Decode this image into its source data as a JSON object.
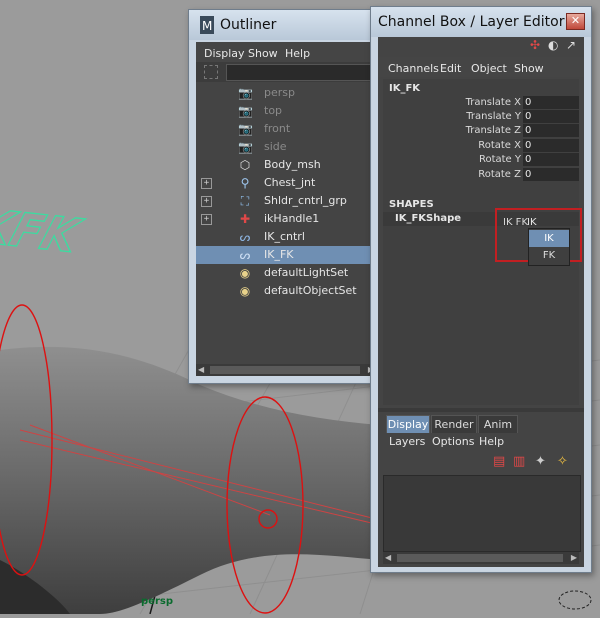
{
  "viewport": {
    "panel_label": "persp",
    "logo_text": "IKFK"
  },
  "outliner": {
    "title": "Outliner",
    "menu": [
      "Display",
      "Show",
      "Help"
    ],
    "items": [
      {
        "label": "persp",
        "icon": "camera-icon",
        "dim": true
      },
      {
        "label": "top",
        "icon": "camera-icon",
        "dim": true
      },
      {
        "label": "front",
        "icon": "camera-icon",
        "dim": true
      },
      {
        "label": "side",
        "icon": "camera-icon",
        "dim": true
      },
      {
        "label": "Body_msh",
        "icon": "mesh-icon",
        "dim": false
      },
      {
        "label": "Chest_jnt",
        "icon": "joint-icon",
        "dim": false,
        "expand": "+"
      },
      {
        "label": "Shldr_cntrl_grp",
        "icon": "group-icon",
        "dim": false,
        "expand": "+"
      },
      {
        "label": "ikHandle1",
        "icon": "ik-handle-icon",
        "dim": false,
        "expand": "+"
      },
      {
        "label": "IK_cntrl",
        "icon": "curve-icon",
        "dim": false
      },
      {
        "label": "IK_FK",
        "icon": "curve-icon",
        "dim": false,
        "selected": true
      },
      {
        "label": "defaultLightSet",
        "icon": "set-icon",
        "dim": false
      },
      {
        "label": "defaultObjectSet",
        "icon": "set-icon",
        "dim": false
      }
    ]
  },
  "channelbox": {
    "title": "Channel Box / Layer Editor",
    "close_glyph": "✕",
    "menu": [
      "Channels",
      "Edit",
      "Object",
      "Show"
    ],
    "node_name": "IK_FK",
    "channels": [
      {
        "label": "Translate X",
        "value": "0"
      },
      {
        "label": "Translate Y",
        "value": "0"
      },
      {
        "label": "Translate Z",
        "value": "0"
      },
      {
        "label": "Rotate X",
        "value": "0"
      },
      {
        "label": "Rotate Y",
        "value": "0"
      },
      {
        "label": "Rotate Z",
        "value": "0"
      }
    ],
    "enum_channel": {
      "label": "IK FK",
      "value": "IK",
      "options": [
        "IK",
        "FK"
      ],
      "selected": "IK"
    },
    "shapes_header": "SHAPES",
    "shape_name": "IK_FKShape",
    "layer_tabs": [
      "Display",
      "Render",
      "Anim"
    ],
    "active_tab": "Display",
    "layer_menu": [
      "Layers",
      "Options",
      "Help"
    ]
  },
  "colors": {
    "selection": "#6f8fb3",
    "highlight_box": "#c21f22",
    "logo": "#3cdca0"
  }
}
